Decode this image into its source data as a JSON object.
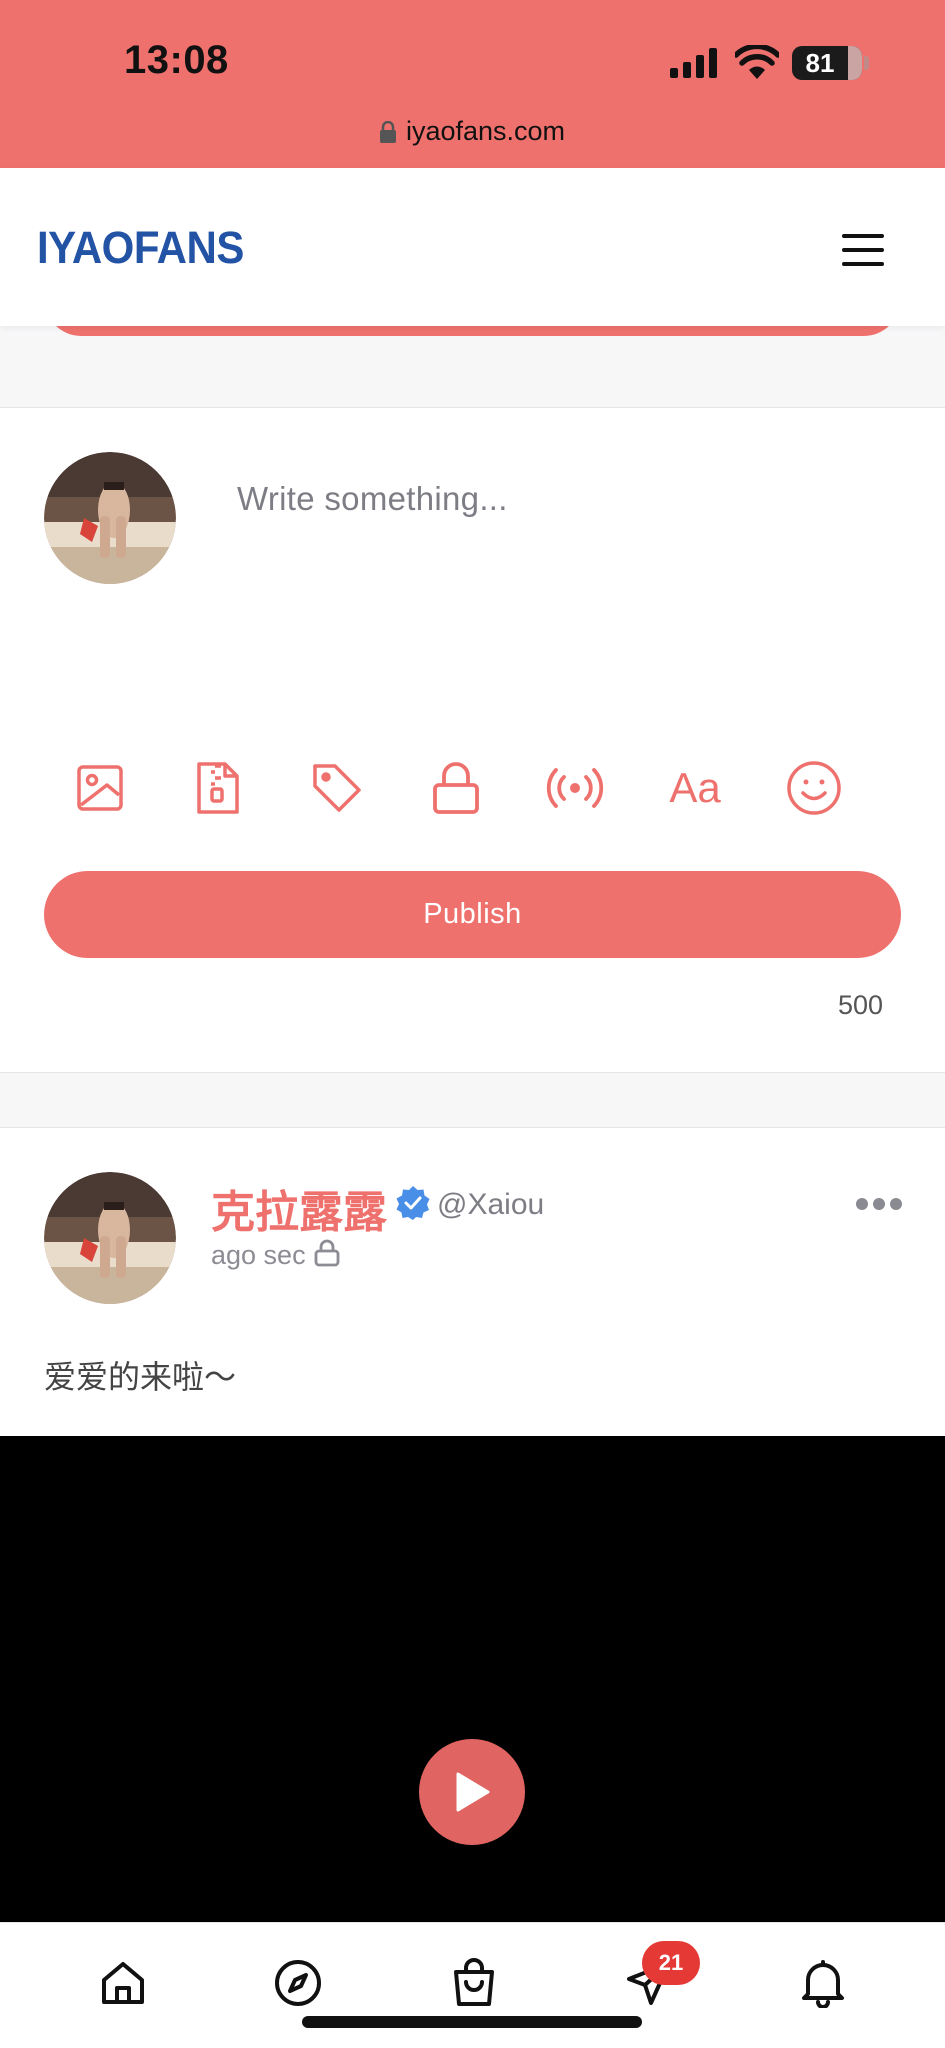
{
  "status_bar": {
    "time": "13:08",
    "battery_level": "81",
    "url": "iyaofans.com"
  },
  "header": {
    "logo": "IYAOFANS",
    "menu_icon": "hamburger-menu-icon"
  },
  "composer": {
    "placeholder": "Write something...",
    "tools": [
      {
        "name": "image-icon"
      },
      {
        "name": "zip-file-icon"
      },
      {
        "name": "tag-icon"
      },
      {
        "name": "lock-icon"
      },
      {
        "name": "live-broadcast-icon"
      },
      {
        "name": "text-format-icon",
        "label": "Aa"
      },
      {
        "name": "emoji-icon"
      }
    ],
    "publish_label": "Publish",
    "char_counter": "500"
  },
  "post": {
    "author_name": "克拉露露",
    "handle": "@Xaiou",
    "time": "ago sec",
    "text": "爱爱的来啦～",
    "more_icon": "more-dots-icon"
  },
  "bottom_nav": {
    "items": [
      {
        "name": "home-icon"
      },
      {
        "name": "explore-compass-icon"
      },
      {
        "name": "shopping-bag-icon"
      },
      {
        "name": "messages-send-icon"
      },
      {
        "name": "notifications-bell-icon"
      }
    ],
    "messages_badge": "21"
  },
  "colors": {
    "accent": "#ee716d",
    "logo": "#2353a5",
    "verified": "#4a8fe7",
    "badge": "#e53935"
  }
}
